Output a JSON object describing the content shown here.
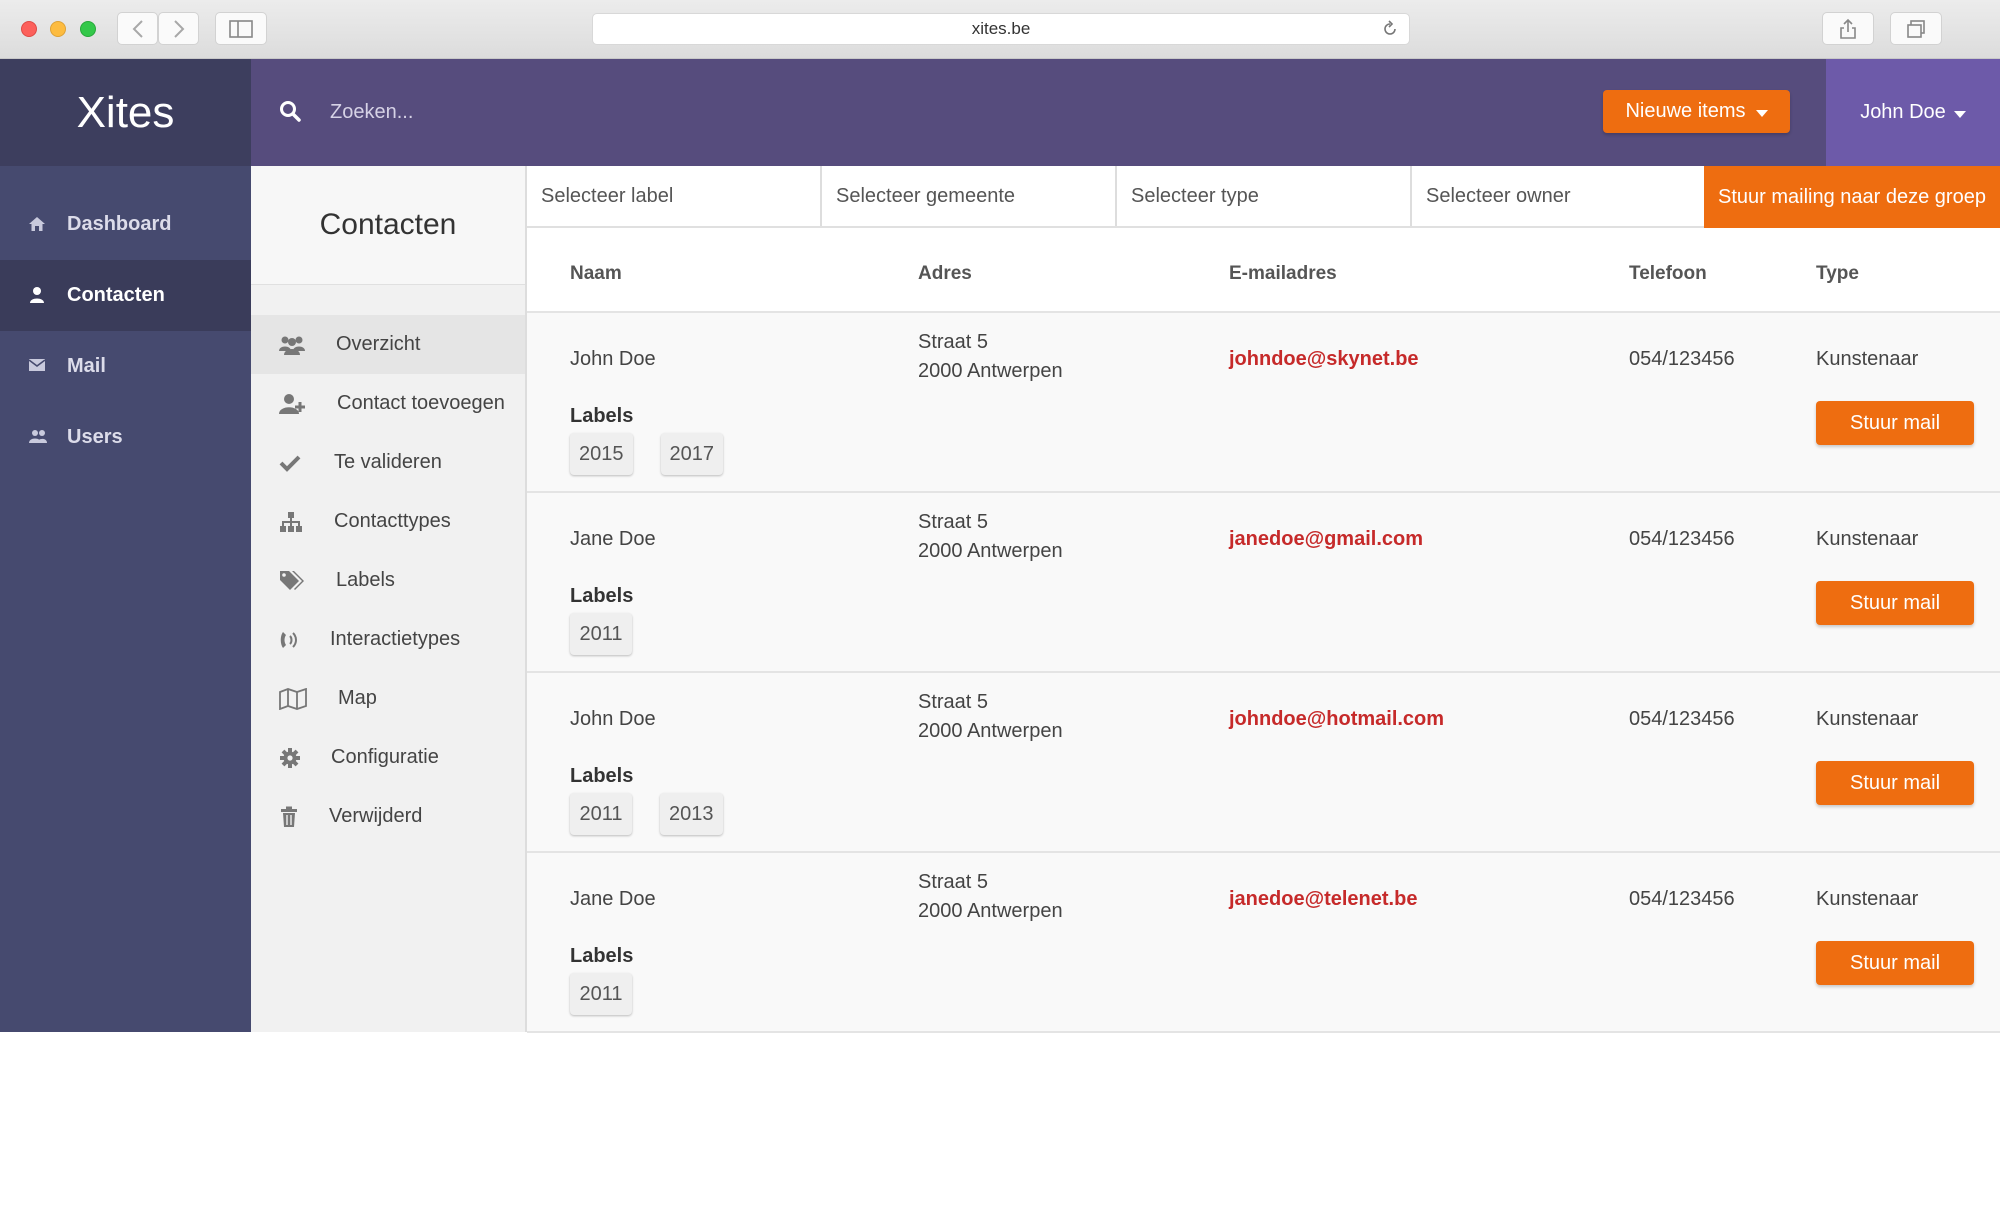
{
  "browser": {
    "url": "xites.be"
  },
  "header": {
    "logo": "Xites",
    "search_placeholder": "Zoeken...",
    "new_items_label": "Nieuwe items",
    "user_name": "John Doe"
  },
  "sidebar": {
    "items": [
      {
        "label": "Dashboard",
        "icon": "home-icon",
        "active": false
      },
      {
        "label": "Contacten",
        "icon": "user-icon",
        "active": true
      },
      {
        "label": "Mail",
        "icon": "envelope-icon",
        "active": false
      },
      {
        "label": "Users",
        "icon": "users-icon",
        "active": false
      }
    ]
  },
  "subnav": {
    "title": "Contacten",
    "items": [
      {
        "label": "Overzicht",
        "icon": "group-icon",
        "active": true
      },
      {
        "label": "Contact toevoegen",
        "icon": "user-plus-icon",
        "active": false
      },
      {
        "label": "Te valideren",
        "icon": "check-icon",
        "active": false
      },
      {
        "label": "Contacttypes",
        "icon": "sitemap-icon",
        "active": false
      },
      {
        "label": "Labels",
        "icon": "tags-icon",
        "active": false
      },
      {
        "label": "Interactietypes",
        "icon": "phone-volume-icon",
        "active": false
      },
      {
        "label": "Map",
        "icon": "map-icon",
        "active": false
      },
      {
        "label": "Configuratie",
        "icon": "cog-icon",
        "active": false
      },
      {
        "label": "Verwijderd",
        "icon": "trash-icon",
        "active": false
      }
    ]
  },
  "filters": {
    "label": "Selecteer label",
    "gemeente": "Selecteer gemeente",
    "type": "Selecteer type",
    "owner": "Selecteer owner",
    "mailing_button": "Stuur mailing naar deze groep"
  },
  "table": {
    "headers": {
      "name": "Naam",
      "address": "Adres",
      "email": "E-mailadres",
      "phone": "Telefoon",
      "type": "Type"
    },
    "labels_title": "Labels",
    "mail_button": "Stuur mail",
    "rows": [
      {
        "name": "John Doe",
        "street": "Straat 5",
        "city": "2000 Antwerpen",
        "email": "johndoe@skynet.be",
        "phone": "054/123456",
        "type": "Kunstenaar",
        "labels": [
          "2015",
          "2017"
        ]
      },
      {
        "name": "Jane Doe",
        "street": "Straat 5",
        "city": "2000 Antwerpen",
        "email": "janedoe@gmail.com",
        "phone": "054/123456",
        "type": "Kunstenaar",
        "labels": [
          "2011"
        ]
      },
      {
        "name": "John Doe",
        "street": "Straat 5",
        "city": "2000 Antwerpen",
        "email": "johndoe@hotmail.com",
        "phone": "054/123456",
        "type": "Kunstenaar",
        "labels": [
          "2011",
          "2013"
        ]
      },
      {
        "name": "Jane Doe",
        "street": "Straat 5",
        "city": "2000 Antwerpen",
        "email": "janedoe@telenet.be",
        "phone": "054/123456",
        "type": "Kunstenaar",
        "labels": [
          "2011"
        ]
      }
    ]
  },
  "colors": {
    "accent": "#ee6d10",
    "header": "#564c7d",
    "sidebar": "#464a6f",
    "email": "#c62a2a"
  }
}
